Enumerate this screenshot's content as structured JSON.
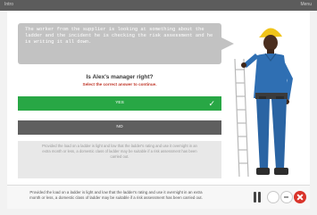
{
  "window": {
    "title": "Intro",
    "menu": "Menu"
  },
  "scenario": {
    "speech": "The worker from the supplier is looking at something about the ladder and the incident he is checking the risk assessment and he is writing it all down.",
    "question": "Is Alex's manager right?",
    "instruction": "Select the correct answer to continue."
  },
  "answers": {
    "yes_label": "YES",
    "no_label": "NO",
    "selected": "YES"
  },
  "feedback": {
    "text": "Provided the load on a ladder is light and low that the ladder's rating and use it overnight in an extra month or less, a domestic class of ladder may be suitable if a risk assessment has been carried out."
  },
  "footer": {
    "transcript": "Provided the load on a ladder is light and low that the ladder's rating and use it overnight in an extra month or less, a domestic class of ladder may be suitable if a risk assessment has been carried out."
  },
  "colors": {
    "correct": "#28a745",
    "close": "#d9342b"
  }
}
